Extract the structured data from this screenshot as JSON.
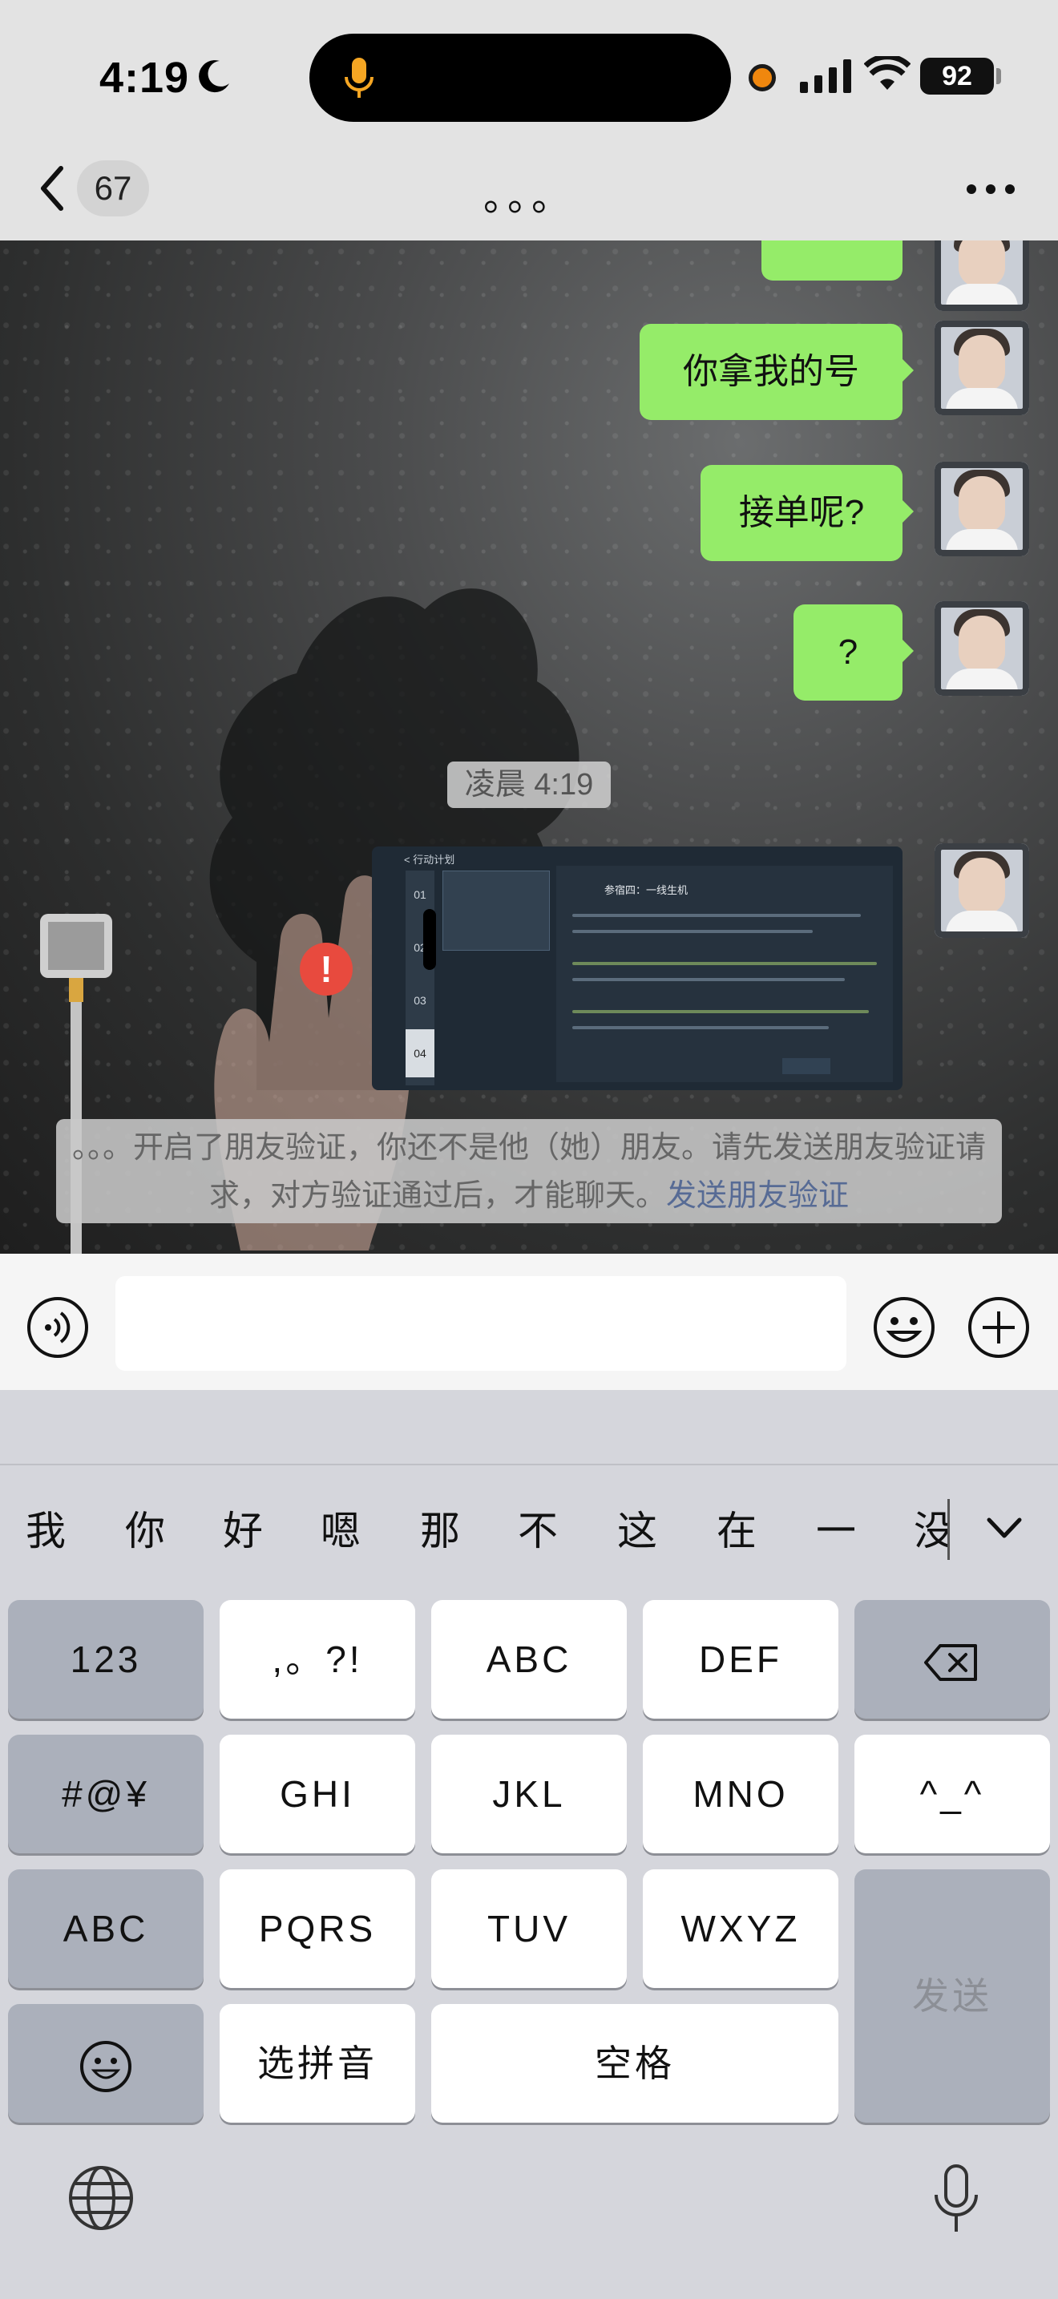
{
  "status_bar": {
    "time": "4:19",
    "battery": "92"
  },
  "nav": {
    "unread_count": "67",
    "title": "。。。"
  },
  "messages": [
    {
      "text": "你拿我的号"
    },
    {
      "text": "接单呢?"
    },
    {
      "text": "?"
    }
  ],
  "timestamp": "凌晨 4:19",
  "screenshot": {
    "header": "< 行动计划",
    "title": "参宿四：一线生机",
    "tabs": [
      "01",
      "02",
      "03",
      "04"
    ]
  },
  "error_mark": "!",
  "notice": {
    "text": "。。。开启了朋友验证，你还不是他（她）朋友。请先发送朋友验证请求，对方验证通过后，才能聊天。",
    "link": "发送朋友验证"
  },
  "keyboard": {
    "candidates": [
      "我",
      "你",
      "好",
      "嗯",
      "那",
      "不",
      "这",
      "在",
      "一",
      "没"
    ],
    "keys": {
      "num": "123",
      "punct": ",。?!",
      "abc": "ABC",
      "def": "DEF",
      "sym": "#@¥",
      "ghi": "GHI",
      "jkl": "JKL",
      "mno": "MNO",
      "face": "^_^",
      "abc_mode": "ABC",
      "pqrs": "PQRS",
      "tuv": "TUV",
      "wxyz": "WXYZ",
      "send": "发送",
      "pinyin": "选拼音",
      "space": "空格"
    }
  },
  "colors": {
    "bubble": "#95ec69",
    "link": "#576b95",
    "error": "#e84a3e"
  }
}
